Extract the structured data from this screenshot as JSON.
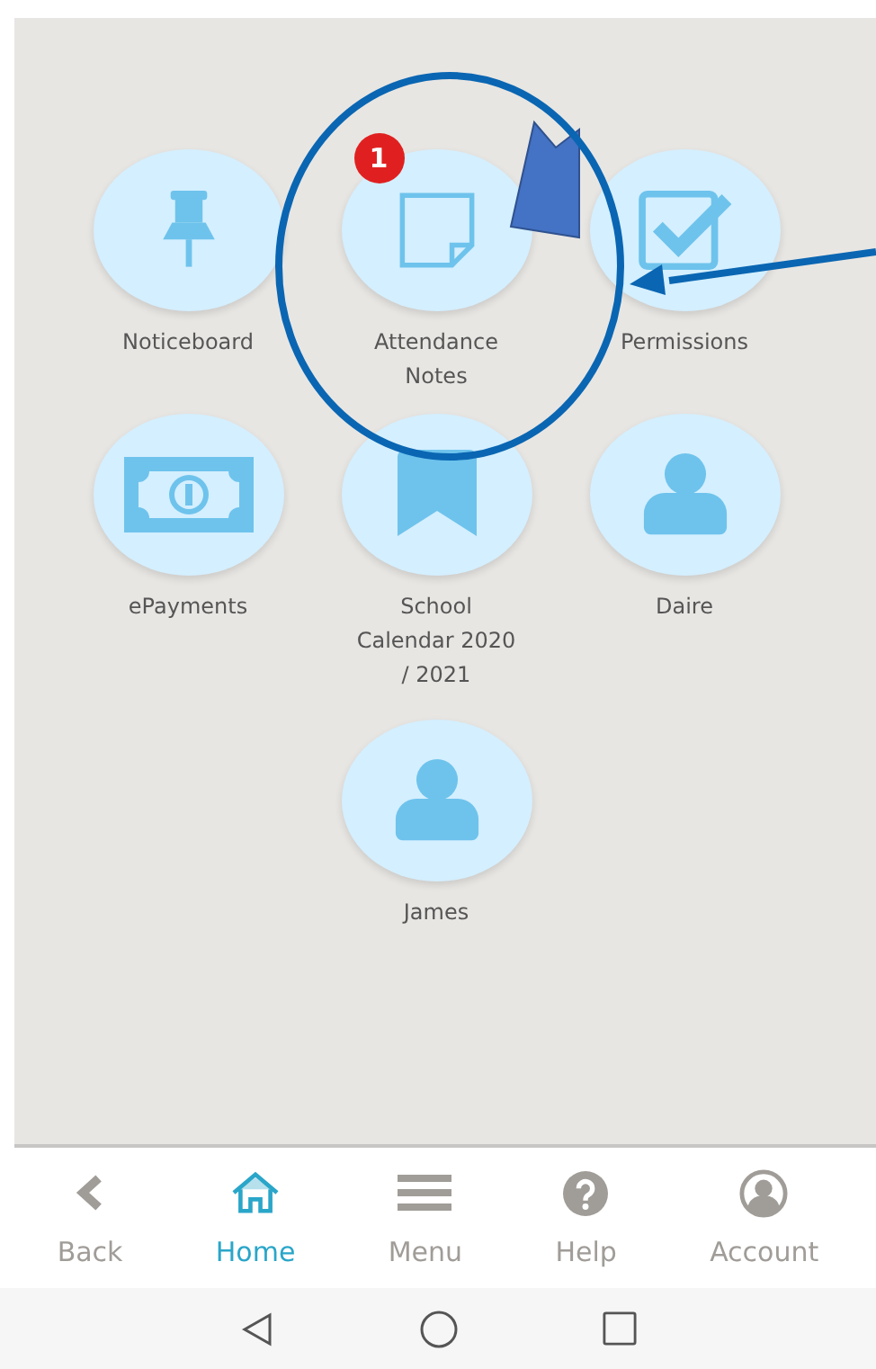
{
  "tiles": [
    {
      "label": "Noticeboard"
    },
    {
      "label": "Attendance Notes",
      "badge": "1"
    },
    {
      "label": "Permissions"
    },
    {
      "label": "ePayments"
    },
    {
      "label": "School Calendar 2020 / 2021"
    },
    {
      "label": "Daire"
    },
    {
      "label": "James"
    }
  ],
  "nav": [
    {
      "label": "Back",
      "selected": false
    },
    {
      "label": "Home",
      "selected": true
    },
    {
      "label": "Menu",
      "selected": false
    },
    {
      "label": "Help",
      "selected": false
    },
    {
      "label": "Account",
      "selected": false
    }
  ]
}
